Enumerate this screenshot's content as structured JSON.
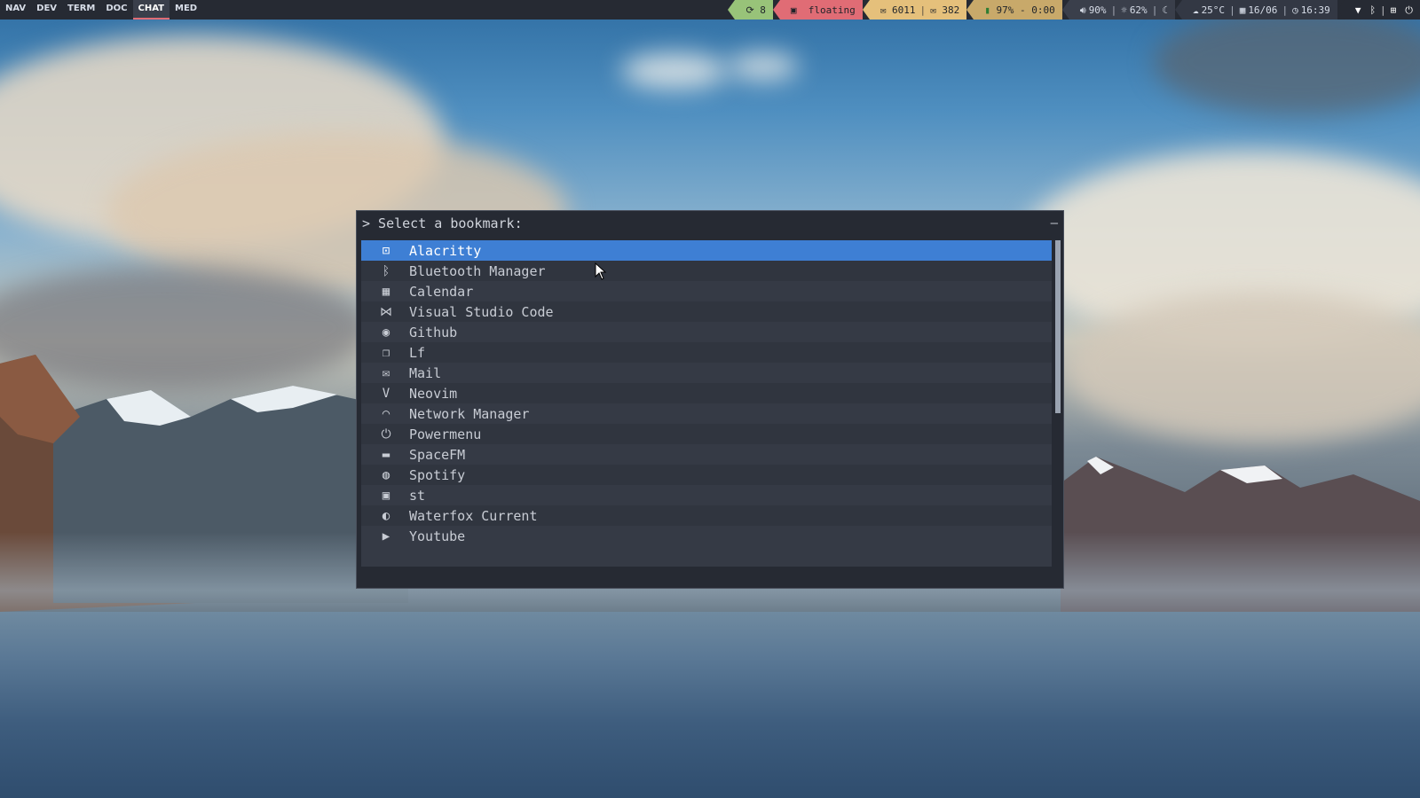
{
  "workspaces": [
    {
      "label": "NAV",
      "active": false
    },
    {
      "label": "DEV",
      "active": false
    },
    {
      "label": "TERM",
      "active": false
    },
    {
      "label": "DOC",
      "active": false
    },
    {
      "label": "CHAT",
      "active": true
    },
    {
      "label": "MED",
      "active": false
    }
  ],
  "bar": {
    "updates_icon": "refresh-icon",
    "updates_count": "8",
    "window_mode": "floating",
    "mail_count": "6011",
    "mail2_count": "382",
    "battery": "97% - 0:00",
    "volume": "90%",
    "brightness": "62%",
    "temperature": "25°C",
    "date": "16/06",
    "time": "16:39"
  },
  "menu": {
    "prompt": "> Select a bookmark:",
    "minimize": "–",
    "items": [
      {
        "label": "Alacritty",
        "icon": "terminal-icon"
      },
      {
        "label": "Bluetooth Manager",
        "icon": "bluetooth-icon"
      },
      {
        "label": "Calendar",
        "icon": "calendar-icon"
      },
      {
        "label": "Visual Studio Code",
        "icon": "vscode-icon"
      },
      {
        "label": "Github",
        "icon": "github-icon"
      },
      {
        "label": "Lf",
        "icon": "file-manager-icon"
      },
      {
        "label": "Mail",
        "icon": "mail-icon"
      },
      {
        "label": "Neovim",
        "icon": "neovim-icon"
      },
      {
        "label": "Network Manager",
        "icon": "wifi-icon"
      },
      {
        "label": "Powermenu",
        "icon": "power-icon"
      },
      {
        "label": "SpaceFM",
        "icon": "folder-icon"
      },
      {
        "label": "Spotify",
        "icon": "spotify-icon"
      },
      {
        "label": "st",
        "icon": "terminal-small-icon"
      },
      {
        "label": "Waterfox Current",
        "icon": "waterfox-icon"
      },
      {
        "label": "Youtube",
        "icon": "youtube-icon"
      }
    ],
    "selected_index": 0
  },
  "colors": {
    "bar_bg": "#262a33",
    "accent_red": "#e06c75",
    "accent_green": "#98c379",
    "accent_yellow": "#e5c07b",
    "selection_blue": "#3e7fd4",
    "menu_bg": "#262a33"
  }
}
